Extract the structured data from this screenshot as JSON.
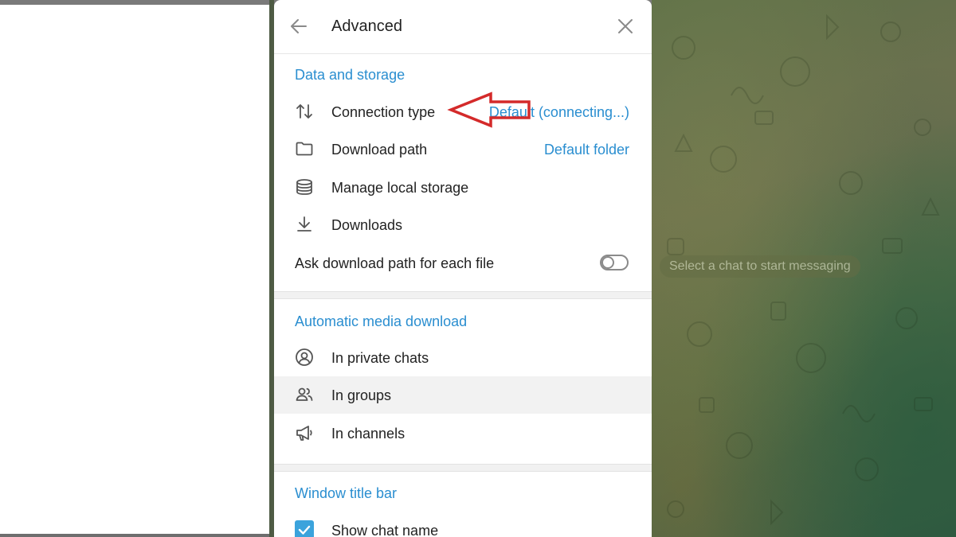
{
  "panel": {
    "title": "Advanced",
    "sections": {
      "data_storage": {
        "title": "Data and storage",
        "connection_type": {
          "label": "Connection type",
          "value": "Default (connecting...)"
        },
        "download_path": {
          "label": "Download path",
          "value": "Default folder"
        },
        "manage_storage": {
          "label": "Manage local storage"
        },
        "downloads": {
          "label": "Downloads"
        },
        "ask_path": {
          "label": "Ask download path for each file",
          "enabled": false
        }
      },
      "auto_media": {
        "title": "Automatic media download",
        "private": {
          "label": "In private chats"
        },
        "groups": {
          "label": "In groups"
        },
        "channels": {
          "label": "In channels"
        }
      },
      "title_bar": {
        "title": "Window title bar",
        "show_chat_name": {
          "label": "Show chat name",
          "checked": true
        }
      }
    }
  },
  "chat_area": {
    "empty_message": "Select a chat to start messaging"
  },
  "colors": {
    "accent": "#2a8ed0",
    "annotation_arrow": "#d42a2a",
    "checkbox": "#3ba3dc"
  },
  "icons": {
    "back": "arrow-left-icon",
    "close": "close-icon",
    "connection": "up-down-arrows-icon",
    "folder": "folder-icon",
    "storage": "database-stack-icon",
    "downloads": "download-icon",
    "private": "user-circle-icon",
    "groups": "users-icon",
    "channels": "megaphone-icon"
  }
}
